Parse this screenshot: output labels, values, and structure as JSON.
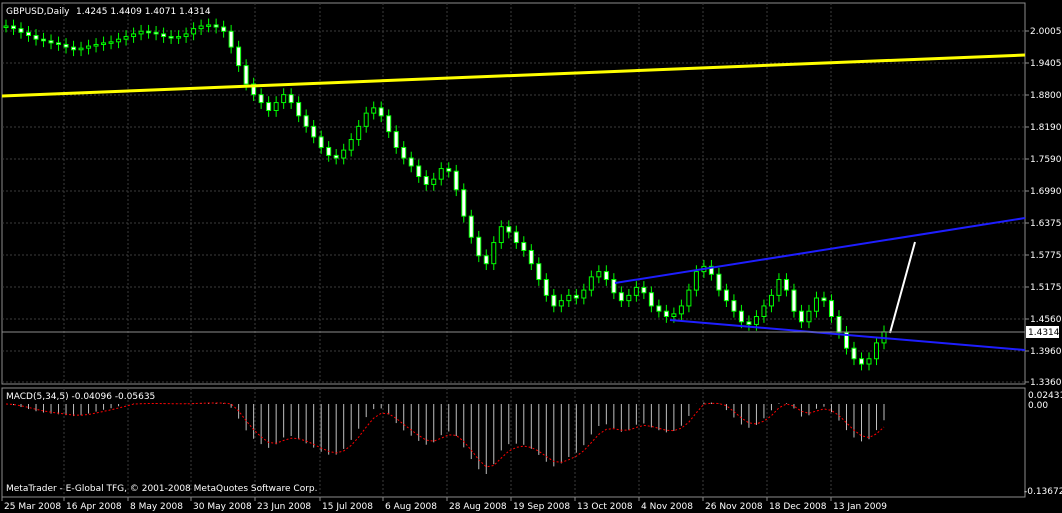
{
  "header": {
    "symbol_tf": "GBPUSD,Daily",
    "ohlc": "1.4245 1.4409 1.4071 1.4314"
  },
  "colors": {
    "background": "#000000",
    "grid": "#3c3c3c",
    "bull_candle": "#00ff00",
    "trendline_yellow": "#ffff00",
    "trendline_blue": "#1e1eff",
    "projection": "#ffffff",
    "macd_histogram": "#c0c0c0",
    "macd_signal": "#ff0000"
  },
  "price_axis": {
    "labels": [
      "2.0005",
      "1.9405",
      "1.8800",
      "1.8190",
      "1.7590",
      "1.6990",
      "1.6375",
      "1.5775",
      "1.5175",
      "1.4560",
      "1.3960",
      "1.3360"
    ],
    "current_price": "1.4314"
  },
  "date_axis": {
    "labels": [
      "25 Mar 2008",
      "16 Apr 2008",
      "8 May 2008",
      "30 May 2008",
      "23 Jun 2008",
      "15 Jul 2008",
      "6 Aug 2008",
      "28 Aug 2008",
      "19 Sep 2008",
      "13 Oct 2008",
      "4 Nov 2008",
      "26 Nov 2008",
      "18 Dec 2008",
      "13 Jan 2009"
    ]
  },
  "indicator": {
    "title": "MACD(5,34,5) -0.04096 -0.05635",
    "scale_top": "0.02431",
    "scale_zero": "0.00",
    "scale_bottom": "-0.13672"
  },
  "copyright": "MetaTrader - E-Global TFG, © 2001-2008 MetaQuotes Software Corp.",
  "chart_data": {
    "type": "line",
    "title": "GBPUSD,Daily",
    "ylim": [
      1.336,
      2.0005
    ],
    "series": [
      {
        "values": [
          2.01,
          2.005,
          1.998,
          1.992,
          1.985,
          1.982,
          1.978,
          1.975,
          1.97,
          1.965,
          1.968,
          1.972,
          1.975,
          1.978,
          1.98,
          1.985,
          1.99,
          1.995,
          2.0,
          1.998,
          1.995,
          1.99,
          1.988,
          1.99,
          1.995,
          2.005,
          2.01,
          2.012,
          2.008,
          2.0,
          1.97,
          1.935,
          1.9,
          1.88,
          1.865,
          1.85,
          1.865,
          1.88,
          1.865,
          1.84,
          1.82,
          1.8,
          1.78,
          1.765,
          1.76,
          1.775,
          1.795,
          1.82,
          1.845,
          1.855,
          1.84,
          1.81,
          1.78,
          1.76,
          1.745,
          1.725,
          1.71,
          1.72,
          1.74,
          1.735,
          1.7,
          1.65,
          1.61,
          1.575,
          1.56,
          1.6,
          1.63,
          1.62,
          1.6,
          1.585,
          1.56,
          1.53,
          1.5,
          1.48,
          1.49,
          1.5,
          1.495,
          1.51,
          1.535,
          1.545,
          1.53,
          1.505,
          1.49,
          1.5,
          1.515,
          1.505,
          1.48,
          1.47,
          1.46,
          1.465,
          1.48,
          1.51,
          1.545,
          1.555,
          1.54,
          1.51,
          1.49,
          1.47,
          1.45,
          1.445,
          1.46,
          1.48,
          1.5,
          1.53,
          1.51,
          1.47,
          1.45,
          1.47,
          1.495,
          1.49,
          1.46,
          1.43,
          1.4,
          1.38,
          1.37,
          1.38,
          1.41,
          1.431
        ]
      }
    ]
  }
}
